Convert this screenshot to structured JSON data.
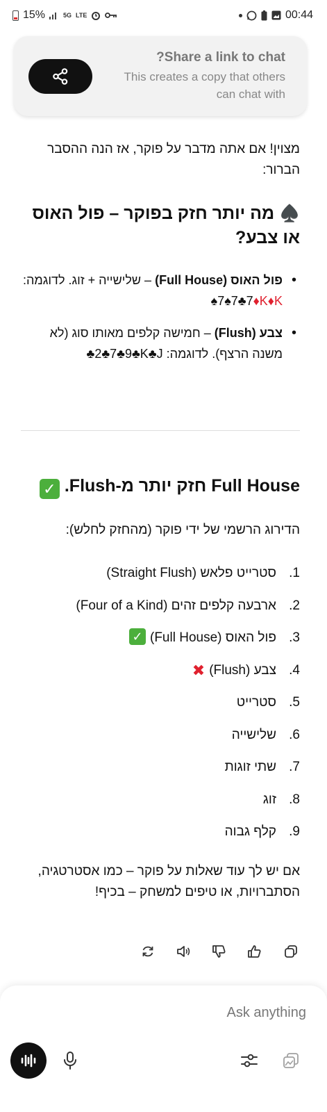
{
  "status_bar": {
    "battery": "15%",
    "signal_1": "5G",
    "signal_2": "LTE",
    "time": "00:44"
  },
  "share_card": {
    "title": "?Share a link to chat",
    "subtitle": "This creates a copy that others can chat with"
  },
  "message": {
    "intro": "מצוין! אם אתה מדבר על פוקר, אז הנה ההסבר הברור:",
    "heading_icon": "♠️",
    "heading": "מה יותר חזק בפוקר – פול האוס או צבע?",
    "bullets": [
      {
        "term": "פול האוס (Full House)",
        "desc": " – שלישייה + זוג. לדוגמה: ",
        "example_a": "♠7♠7♣7",
        "example_b": "♦K♦K"
      },
      {
        "term": "צבע (Flush)",
        "desc": " – חמישה קלפים מאותו סוג (לא משנה הרצף). לדוגמה: ",
        "example": "♣2♣7♣9♣K♣J"
      }
    ],
    "conclusion": "Full House חזק יותר מ-Flush.",
    "conclusion_icon": "✓",
    "ranking_intro": "הדירוג הרשמי של ידי פוקר (מהחזק לחלש):",
    "ranking": [
      {
        "num": "1.",
        "text": "סטרייט פלאש (Straight Flush)",
        "mark": ""
      },
      {
        "num": "2.",
        "text": "ארבעה קלפים זהים (Four of a Kind)",
        "mark": ""
      },
      {
        "num": "3.",
        "text": "פול האוס (Full House)",
        "mark": "check"
      },
      {
        "num": "4.",
        "text": "צבע (Flush)",
        "mark": "cross"
      },
      {
        "num": "5.",
        "text": "סטרייט",
        "mark": ""
      },
      {
        "num": "6.",
        "text": "שלישייה",
        "mark": ""
      },
      {
        "num": "7.",
        "text": "שתי זוגות",
        "mark": ""
      },
      {
        "num": "8.",
        "text": "זוג",
        "mark": ""
      },
      {
        "num": "9.",
        "text": "קלף גבוה",
        "mark": ""
      }
    ],
    "outro": "אם יש לך עוד שאלות על פוקר – כמו אסטרטגיה, הסתברויות, או טיפים למשחק – בכיף!"
  },
  "actions": [
    "copy-icon",
    "thumbs-up-icon",
    "thumbs-down-icon",
    "speaker-icon",
    "regenerate-icon"
  ],
  "composer": {
    "placeholder": "Ask anything"
  },
  "colors": {
    "accent_dark": "#111111",
    "check_green": "#4caf3c",
    "card_red": "#e0202e",
    "card_bg": "#f2f2f2"
  }
}
